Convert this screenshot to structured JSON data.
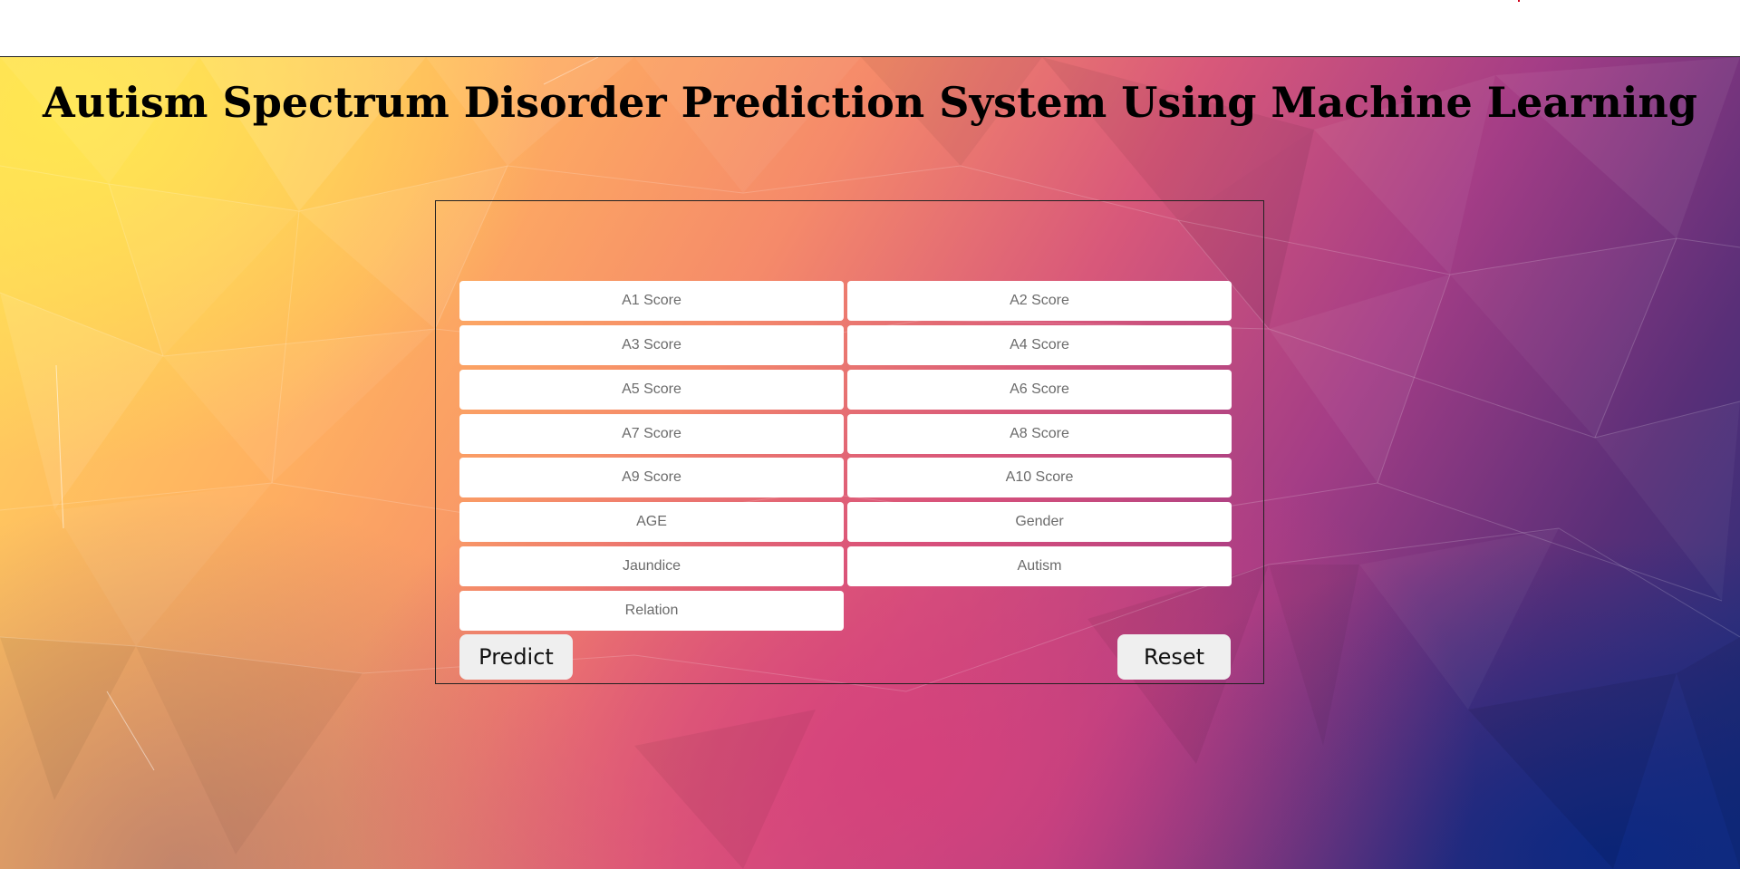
{
  "page": {
    "title": "Autism Spectrum Disorder Prediction System Using Machine Learning"
  },
  "form": {
    "fields": [
      {
        "placeholder": "A1 Score"
      },
      {
        "placeholder": "A2 Score"
      },
      {
        "placeholder": "A3 Score"
      },
      {
        "placeholder": "A4 Score"
      },
      {
        "placeholder": "A5 Score"
      },
      {
        "placeholder": "A6 Score"
      },
      {
        "placeholder": "A7 Score"
      },
      {
        "placeholder": "A8 Score"
      },
      {
        "placeholder": "A9 Score"
      },
      {
        "placeholder": "A10 Score"
      },
      {
        "placeholder": "AGE"
      },
      {
        "placeholder": "Gender"
      },
      {
        "placeholder": "Jaundice"
      },
      {
        "placeholder": "Autism"
      },
      {
        "placeholder": "Relation"
      }
    ],
    "predict_label": "Predict",
    "reset_label": "Reset"
  },
  "colors": {
    "panel_border": "#222222",
    "input_bg": "#ffffff",
    "button_bg": "#efefef",
    "background_top_left": "#ffd95e",
    "background_bottom_right": "#1b2f7a"
  }
}
